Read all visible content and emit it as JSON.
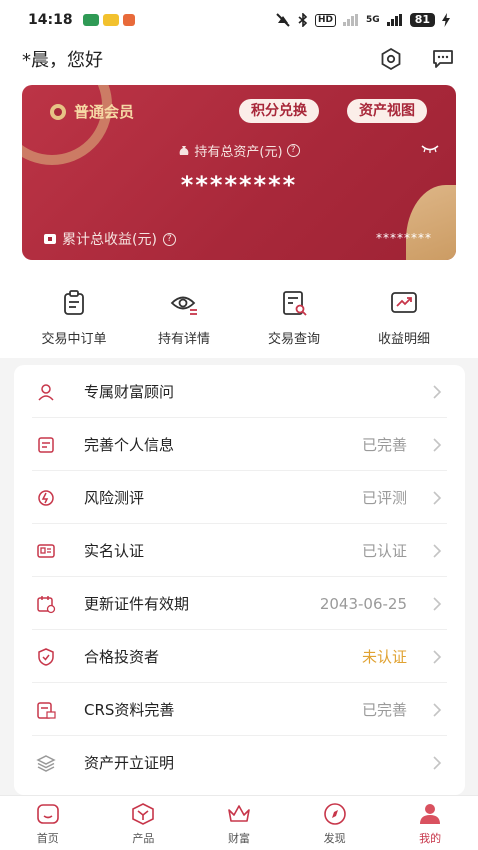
{
  "status_bar": {
    "time": "14:18",
    "battery": "81",
    "network": "5G",
    "hd": "HD"
  },
  "header": {
    "greeting": "*晨，您好"
  },
  "card": {
    "tier": "普通会员",
    "points_button": "积分兑换",
    "assets_button": "资产视图",
    "holding_label": "持有总资产(元)",
    "holding_value": "********",
    "cumulative_label": "累计总收益(元)",
    "cumulative_value": "********"
  },
  "quick_actions": [
    {
      "label": "交易中订单",
      "icon": "order-icon"
    },
    {
      "label": "持有详情",
      "icon": "holding-eye-icon"
    },
    {
      "label": "交易查询",
      "icon": "query-icon"
    },
    {
      "label": "收益明细",
      "icon": "trend-chart-icon"
    }
  ],
  "list": [
    {
      "label": "专属财富顾问",
      "value": "",
      "icon": "advisor-icon"
    },
    {
      "label": "完善个人信息",
      "value": "已完善",
      "icon": "profile-icon"
    },
    {
      "label": "风险测评",
      "value": "已评测",
      "icon": "risk-icon"
    },
    {
      "label": "实名认证",
      "value": "已认证",
      "icon": "id-card-icon"
    },
    {
      "label": "更新证件有效期",
      "value": "2043-06-25",
      "icon": "calendar-icon"
    },
    {
      "label": "合格投资者",
      "value": "未认证",
      "icon": "shield-icon",
      "status": "warn"
    },
    {
      "label": "CRS资料完善",
      "value": "已完善",
      "icon": "crs-icon"
    },
    {
      "label": "资产开立证明",
      "value": "",
      "icon": "layers-icon"
    }
  ],
  "bottom_nav": [
    {
      "label": "首页",
      "icon": "home-icon"
    },
    {
      "label": "产品",
      "icon": "product-icon"
    },
    {
      "label": "财富",
      "icon": "crown-icon"
    },
    {
      "label": "发现",
      "icon": "compass-icon"
    },
    {
      "label": "我的",
      "icon": "user-icon",
      "active": true
    }
  ],
  "colors": {
    "brand": "#a8283a",
    "warn": "#e0a232",
    "active_nav": "#c7364a",
    "gold": "#e7c385"
  }
}
